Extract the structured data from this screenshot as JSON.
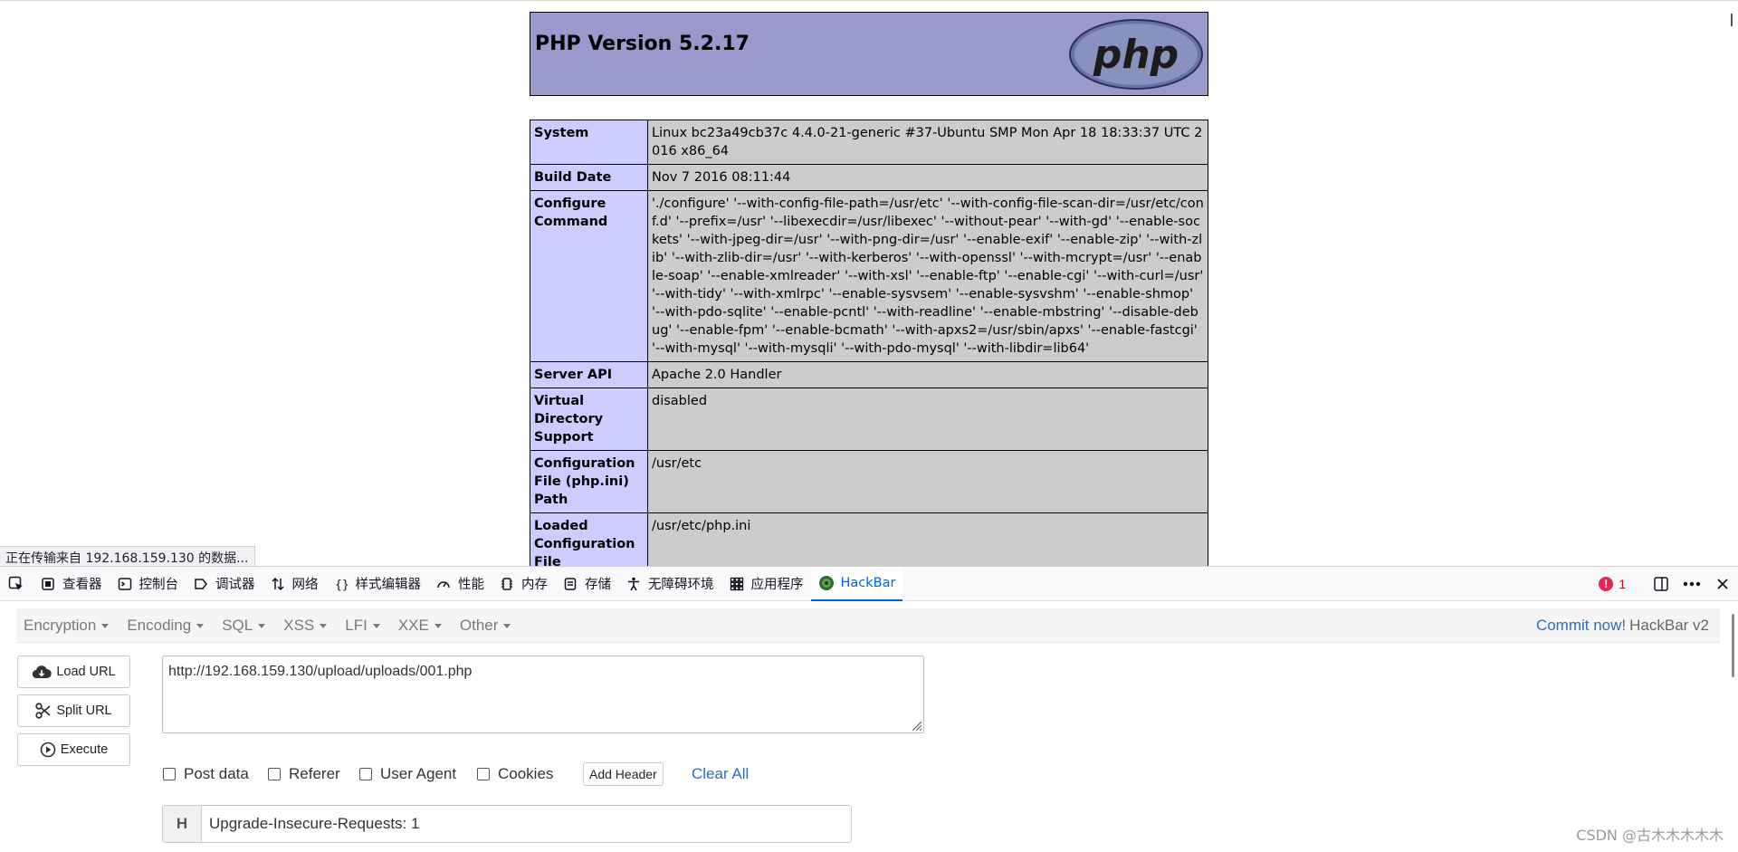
{
  "phpinfo": {
    "title": "PHP Version 5.2.17",
    "logo_text": "php",
    "rows": [
      {
        "key": "System",
        "value": "Linux bc23a49cb37c 4.4.0-21-generic #37-Ubuntu SMP Mon Apr 18 18:33:37 UTC 2016 x86_64"
      },
      {
        "key": "Build Date",
        "value": "Nov 7 2016 08:11:44"
      },
      {
        "key": "Configure Command",
        "value": "'./configure' '--with-config-file-path=/usr/etc' '--with-config-file-scan-dir=/usr/etc/conf.d' '--prefix=/usr' '--libexecdir=/usr/libexec' '--without-pear' '--with-gd' '--enable-sockets' '--with-jpeg-dir=/usr' '--with-png-dir=/usr' '--enable-exif' '--enable-zip' '--with-zlib' '--with-zlib-dir=/usr' '--with-kerberos' '--with-openssl' '--with-mcrypt=/usr' '--enable-soap' '--enable-xmlreader' '--with-xsl' '--enable-ftp' '--enable-cgi' '--with-curl=/usr' '--with-tidy' '--with-xmlrpc' '--enable-sysvsem' '--enable-sysvshm' '--enable-shmop' '--with-pdo-sqlite' '--enable-pcntl' '--with-readline' '--enable-mbstring' '--disable-debug' '--enable-fpm' '--enable-bcmath' '--with-apxs2=/usr/sbin/apxs' '--enable-fastcgi' '--with-mysql' '--with-mysqli' '--with-pdo-mysql' '--with-libdir=lib64'"
      },
      {
        "key": "Server API",
        "value": "Apache 2.0 Handler"
      },
      {
        "key": "Virtual Directory Support",
        "value": "disabled"
      },
      {
        "key": "Configuration File (php.ini) Path",
        "value": "/usr/etc"
      },
      {
        "key": "Loaded Configuration File",
        "value": "/usr/etc/php.ini"
      }
    ]
  },
  "status_text": "正在传输来自 192.168.159.130 的数据...",
  "devtools": {
    "tabs": [
      {
        "label": "查看器",
        "icon": "inspector-icon"
      },
      {
        "label": "控制台",
        "icon": "console-icon"
      },
      {
        "label": "调试器",
        "icon": "debugger-icon"
      },
      {
        "label": "网络",
        "icon": "network-icon"
      },
      {
        "label": "样式编辑器",
        "icon": "style-editor-icon"
      },
      {
        "label": "性能",
        "icon": "performance-icon"
      },
      {
        "label": "内存",
        "icon": "memory-icon"
      },
      {
        "label": "存储",
        "icon": "storage-icon"
      },
      {
        "label": "无障碍环境",
        "icon": "accessibility-icon"
      },
      {
        "label": "应用程序",
        "icon": "application-icon"
      },
      {
        "label": "HackBar",
        "icon": "hackbar-icon"
      }
    ],
    "error_count": "1"
  },
  "hackbar": {
    "menus": [
      "Encryption",
      "Encoding",
      "SQL",
      "XSS",
      "LFI",
      "XXE",
      "Other"
    ],
    "commit_link": "Commit now!",
    "version": "HackBar v2",
    "buttons": {
      "load": "Load URL",
      "split": "Split URL",
      "execute": "Execute"
    },
    "url": "http://192.168.159.130/upload/uploads/001.php",
    "checks": {
      "post": "Post data",
      "referer": "Referer",
      "ua": "User Agent",
      "cookies": "Cookies"
    },
    "add_header": "Add Header",
    "clear_all": "Clear All",
    "header_key": "H",
    "header_value": "Upgrade-Insecure-Requests: 1"
  },
  "watermark": "CSDN @古木木木木木",
  "colors": {
    "php_header": "#9999cc",
    "php_key": "#ccccff",
    "php_value": "#cccccc",
    "accent": "#0061e0",
    "link": "#2a6fbb"
  }
}
